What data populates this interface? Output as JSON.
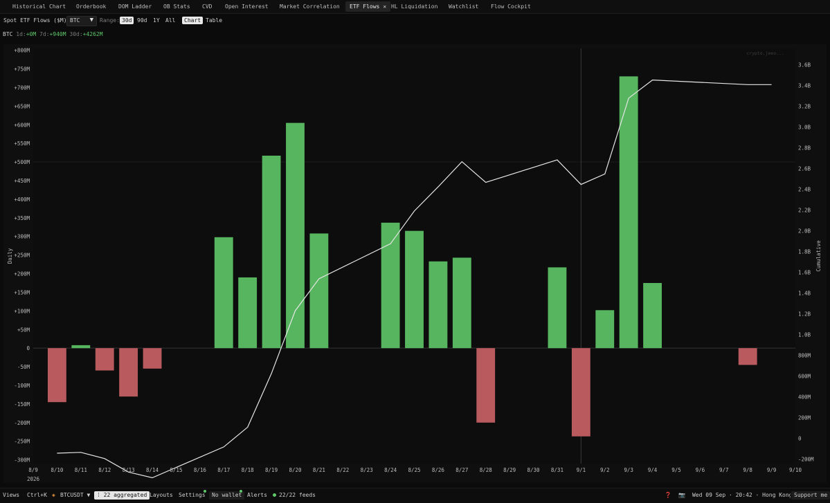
{
  "tabs": [
    {
      "label": "Historical Chart",
      "active": false
    },
    {
      "label": "Orderbook",
      "active": false
    },
    {
      "label": "DOM Ladder",
      "active": false
    },
    {
      "label": "OB Stats",
      "active": false
    },
    {
      "label": "CVD",
      "active": false
    },
    {
      "label": "Open Interest",
      "active": false
    },
    {
      "label": "Market Correlation",
      "active": false
    },
    {
      "label": "ETF Flows",
      "active": true
    },
    {
      "label": "HL Liquidation",
      "active": false
    },
    {
      "label": "Watchlist",
      "active": false
    },
    {
      "label": "Flow Cockpit",
      "active": false
    }
  ],
  "tab_close_glyph": "✕",
  "toolbar": {
    "title": "Spot ETF Flows ($M)",
    "asset_select": "BTC",
    "range_label": "Range:",
    "ranges": [
      "30d",
      "90d",
      "1Y",
      "All"
    ],
    "range_selected": "30d",
    "views": [
      "Chart",
      "Table"
    ],
    "view_selected": "Chart"
  },
  "stats": {
    "asset": "BTC",
    "d1_label": "1d:",
    "d1_value": "+0M",
    "d7_label": "7d:",
    "d7_value": "+940M",
    "d30_label": "30d:",
    "d30_value": "+4262M"
  },
  "chart_data": {
    "type": "bar",
    "watermark": "crypto.jeeo...",
    "ylabel": "Daily",
    "y2label": "Cumulative",
    "ylim": [
      -310,
      805
    ],
    "y_ticks": [
      "+800M",
      "+750M",
      "+700M",
      "+650M",
      "+600M",
      "+550M",
      "+500M",
      "+450M",
      "+400M",
      "+350M",
      "+300M",
      "+250M",
      "+200M",
      "+150M",
      "+100M",
      "+50M",
      "0",
      "-50M",
      "-100M",
      "-150M",
      "-200M",
      "-250M",
      "-300M"
    ],
    "y2_ticks": [
      "3.6B",
      "3.4B",
      "3.2B",
      "3.0B",
      "2.8B",
      "2.6B",
      "2.4B",
      "2.2B",
      "2.0B",
      "1.8B",
      "1.6B",
      "1.4B",
      "1.2B",
      "1.0B",
      "800M",
      "600M",
      "400M",
      "200M",
      "0",
      "-200M"
    ],
    "y2lim": [
      -245,
      3755
    ],
    "x_labels": [
      "8/9",
      "8/10",
      "8/11",
      "8/12",
      "8/13",
      "8/14",
      "8/15",
      "8/16",
      "8/17",
      "8/18",
      "8/19",
      "8/20",
      "8/21",
      "8/22",
      "8/23",
      "8/24",
      "8/25",
      "8/26",
      "8/27",
      "8/28",
      "8/29",
      "8/30",
      "8/31",
      "9/1",
      "9/2",
      "9/3",
      "9/4",
      "9/5",
      "9/6",
      "9/7",
      "9/8",
      "9/9",
      "9/10"
    ],
    "year_label": "2026",
    "categories": [
      "8/10",
      "8/11",
      "8/12",
      "8/13",
      "8/14",
      "8/17",
      "8/18",
      "8/19",
      "8/20",
      "8/21",
      "8/24",
      "8/25",
      "8/26",
      "8/27",
      "8/28",
      "8/31",
      "9/1",
      "9/2",
      "9/3",
      "9/4",
      "9/8"
    ],
    "values": [
      -145,
      8,
      -60,
      -130,
      -55,
      298,
      190,
      517,
      605,
      308,
      337,
      315,
      233,
      243,
      -200,
      217,
      -237,
      102,
      730,
      175,
      -45
    ],
    "cumulative": {
      "x": [
        "8/10",
        "8/11",
        "8/12",
        "8/13",
        "8/14",
        "8/17",
        "8/18",
        "8/19",
        "8/20",
        "8/21",
        "8/24",
        "8/25",
        "8/26",
        "8/27",
        "8/28",
        "8/31",
        "9/1",
        "9/2",
        "9/3",
        "9/4",
        "9/8",
        "9/9"
      ],
      "values": [
        -145,
        -137,
        -197,
        -327,
        -382,
        -84,
        106,
        623,
        1228,
        1536,
        1873,
        2188,
        2421,
        2664,
        2464,
        2681,
        2444,
        2546,
        3276,
        3451,
        3406,
        3406
      ]
    },
    "colors": {
      "positive": "#57b55f",
      "negative": "#b95a5f",
      "line": "#e6e6e6",
      "grid": "#1c1c1c",
      "zero": "#333333"
    },
    "crosshair_at": "9/1"
  },
  "statusbar": {
    "views": "Views",
    "shortcut": "Ctrl+K",
    "symbol": "BTCUSDT",
    "aggregated": "22 aggregated",
    "layouts": "Layouts",
    "settings": "Settings",
    "wallet": "No wallet",
    "alerts": "Alerts",
    "feeds": "22/22 feeds",
    "datetime": "Wed 09 Sep · 20:42 · Hong Kong",
    "support": "Support me"
  }
}
